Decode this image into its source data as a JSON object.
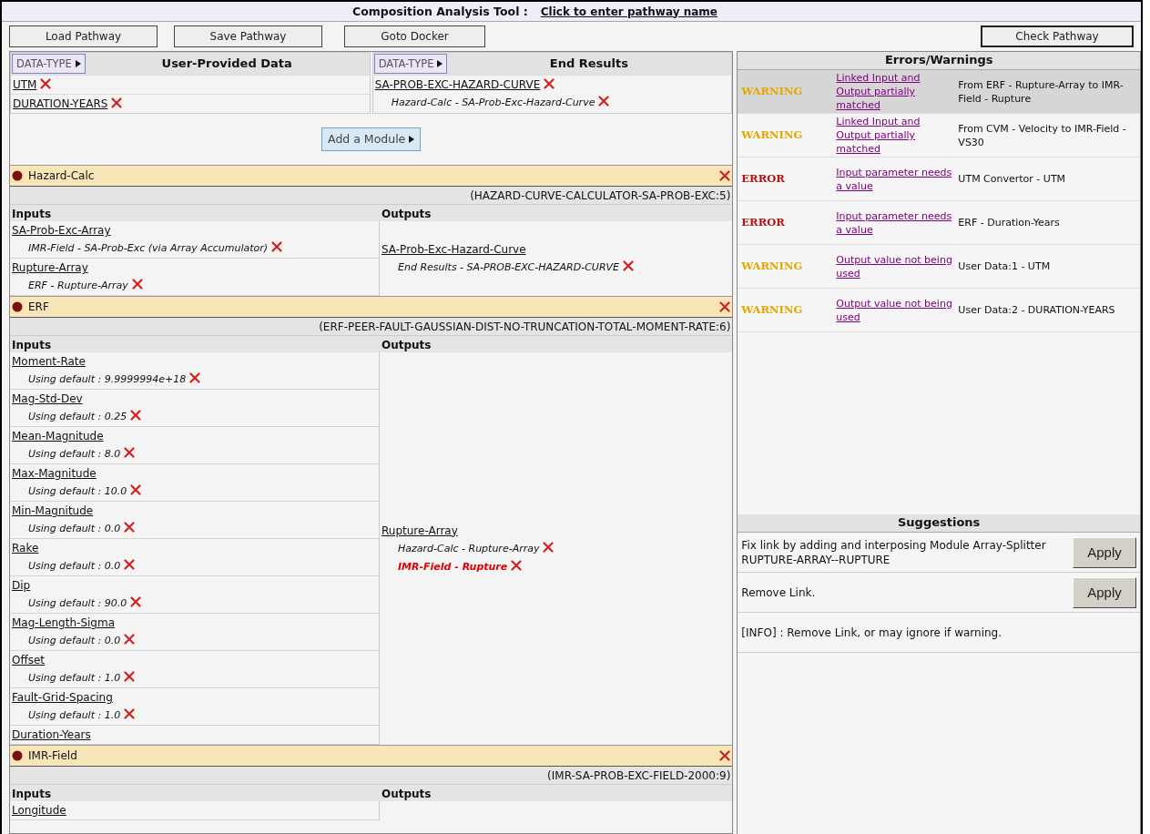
{
  "header": {
    "title": "Composition Analysis Tool :",
    "pathway_link": "Click to enter pathway name"
  },
  "toolbar": {
    "left_buttons": [
      "Load Pathway",
      "Save Pathway",
      "Goto Docker"
    ],
    "right_button": "Check Pathway"
  },
  "user_data": {
    "button": "DATA-TYPE",
    "title": "User-Provided Data",
    "items": [
      {
        "name": "UTM"
      },
      {
        "name": "DURATION-YEARS"
      }
    ]
  },
  "end_results": {
    "button": "DATA-TYPE",
    "title": "End Results",
    "items": [
      {
        "name": "SA-PROB-EXC-HAZARD-CURVE",
        "lines": [
          {
            "text": "Hazard-Calc - SA-Prob-Exc-Hazard-Curve",
            "highlighted": false
          }
        ]
      }
    ]
  },
  "add_module": "Add a Module",
  "modules": [
    {
      "name": "Hazard-Calc",
      "signature": "(HAZARD-CURVE-CALCULATOR-SA-PROB-EXC:5)",
      "inputs_label": "Inputs",
      "outputs_label": "Outputs",
      "inputs": [
        {
          "name": "SA-Prob-Exc-Array",
          "lines": [
            {
              "text": "IMR-Field - SA-Prob-Exc (via Array Accumulator)",
              "highlighted": false
            }
          ]
        },
        {
          "name": "Rupture-Array",
          "lines": [
            {
              "text": "ERF - Rupture-Array",
              "highlighted": false
            }
          ]
        }
      ],
      "outputs": [
        {
          "name": "SA-Prob-Exc-Hazard-Curve",
          "lines": [
            {
              "text": "End Results - SA-PROB-EXC-HAZARD-CURVE",
              "highlighted": false
            }
          ]
        }
      ]
    },
    {
      "name": "ERF",
      "signature": "(ERF-PEER-FAULT-GAUSSIAN-DIST-NO-TRUNCATION-TOTAL-MOMENT-RATE:6)",
      "inputs_label": "Inputs",
      "outputs_label": "Outputs",
      "inputs": [
        {
          "name": "Moment-Rate",
          "lines": [
            {
              "text": "Using default : 9.9999994e+18",
              "highlighted": false
            }
          ]
        },
        {
          "name": "Mag-Std-Dev",
          "lines": [
            {
              "text": "Using default : 0.25",
              "highlighted": false
            }
          ]
        },
        {
          "name": "Mean-Magnitude",
          "lines": [
            {
              "text": "Using default : 8.0",
              "highlighted": false
            }
          ]
        },
        {
          "name": "Max-Magnitude",
          "lines": [
            {
              "text": "Using default : 10.0",
              "highlighted": false
            }
          ]
        },
        {
          "name": "Min-Magnitude",
          "lines": [
            {
              "text": "Using default : 0.0",
              "highlighted": false
            }
          ]
        },
        {
          "name": "Rake",
          "lines": [
            {
              "text": "Using default : 0.0",
              "highlighted": false
            }
          ]
        },
        {
          "name": "Dip",
          "lines": [
            {
              "text": "Using default : 90.0",
              "highlighted": false
            }
          ]
        },
        {
          "name": "Mag-Length-Sigma",
          "lines": [
            {
              "text": "Using default : 0.0",
              "highlighted": false
            }
          ]
        },
        {
          "name": "Offset",
          "lines": [
            {
              "text": "Using default : 1.0",
              "highlighted": false
            }
          ]
        },
        {
          "name": "Fault-Grid-Spacing",
          "lines": [
            {
              "text": "Using default : 1.0",
              "highlighted": false
            }
          ]
        },
        {
          "name": "Duration-Years"
        }
      ],
      "outputs": [
        {
          "name": "Rupture-Array",
          "lines": [
            {
              "text": "Hazard-Calc - Rupture-Array",
              "highlighted": false
            },
            {
              "text": "IMR-Field - Rupture",
              "highlighted": true
            }
          ]
        }
      ]
    },
    {
      "name": "IMR-Field",
      "signature": "(IMR-SA-PROB-EXC-FIELD-2000:9)",
      "inputs_label": "Inputs",
      "outputs_label": "Outputs",
      "inputs": [
        {
          "name": "Longitude"
        }
      ]
    }
  ],
  "errors_title": "Errors/Warnings",
  "errors": [
    {
      "kind": "warning",
      "severity": "WARNING",
      "message": "Linked Input and Output partially matched",
      "detail": "From ERF - Rupture-Array to IMR-Field - Rupture",
      "selected": true
    },
    {
      "kind": "warning",
      "severity": "WARNING",
      "message": "Linked Input and Output partially matched",
      "detail": "From CVM - Velocity to IMR-Field - VS30",
      "selected": false
    },
    {
      "kind": "error",
      "severity": "ERROR",
      "message": "Input parameter needs a value",
      "detail": "UTM Convertor - UTM",
      "selected": false
    },
    {
      "kind": "error",
      "severity": "ERROR",
      "message": "Input parameter needs a value",
      "detail": "ERF - Duration-Years",
      "selected": false
    },
    {
      "kind": "warning",
      "severity": "WARNING",
      "message": "Output value not being used",
      "detail": "User Data:1 - UTM",
      "selected": false
    },
    {
      "kind": "warning",
      "severity": "WARNING",
      "message": "Output value not being used",
      "detail": "User Data:2 - DURATION-YEARS",
      "selected": false
    }
  ],
  "suggestions_title": "Suggestions",
  "suggestions": [
    {
      "kind": "action",
      "text": "Fix link by adding and interposing Module Array-Splitter RUPTURE-ARRAY--RUPTURE",
      "button": "Apply"
    },
    {
      "kind": "action",
      "text": "Remove Link.",
      "button": "Apply"
    },
    {
      "kind": "info",
      "text": "[INFO] : Remove Link, or may ignore if warning."
    }
  ]
}
